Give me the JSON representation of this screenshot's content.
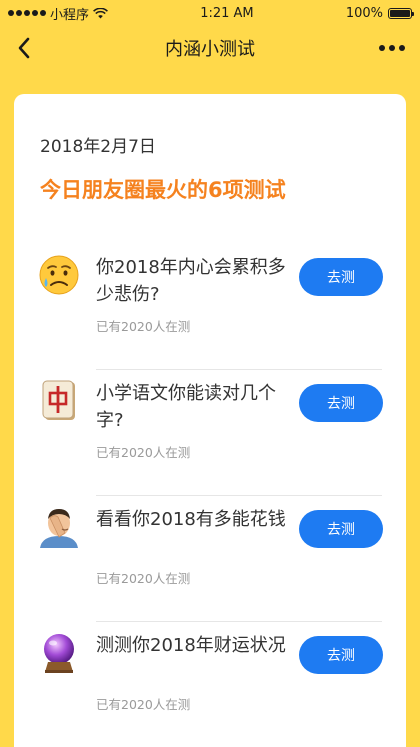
{
  "status_bar": {
    "carrier": "小程序",
    "time": "1:21 AM",
    "battery": "100%",
    "battery_level": 1.0
  },
  "nav": {
    "title": "内涵小测试"
  },
  "card": {
    "date": "2018年2月7日",
    "headline": "今日朋友圈最火的6项测试",
    "items": [
      {
        "title": "你2018年内心会累积多少悲伤?",
        "count": "已有2020人在测",
        "button": "去测",
        "icon": "sad-face-icon"
      },
      {
        "title": "小学语文你能读对几个字?",
        "count": "已有2020人在测",
        "button": "去测",
        "icon": "mahjong-tile-icon"
      },
      {
        "title": "看看你2018有多能花钱",
        "count": "已有2020人在测",
        "button": "去测",
        "icon": "facepalm-man-icon"
      },
      {
        "title": "测测你2018年财运状况",
        "count": "已有2020人在测",
        "button": "去测",
        "icon": "crystal-ball-icon"
      }
    ]
  },
  "colors": {
    "background": "#FFD94A",
    "accent": "#F5821F",
    "button": "#1E7BF2"
  }
}
